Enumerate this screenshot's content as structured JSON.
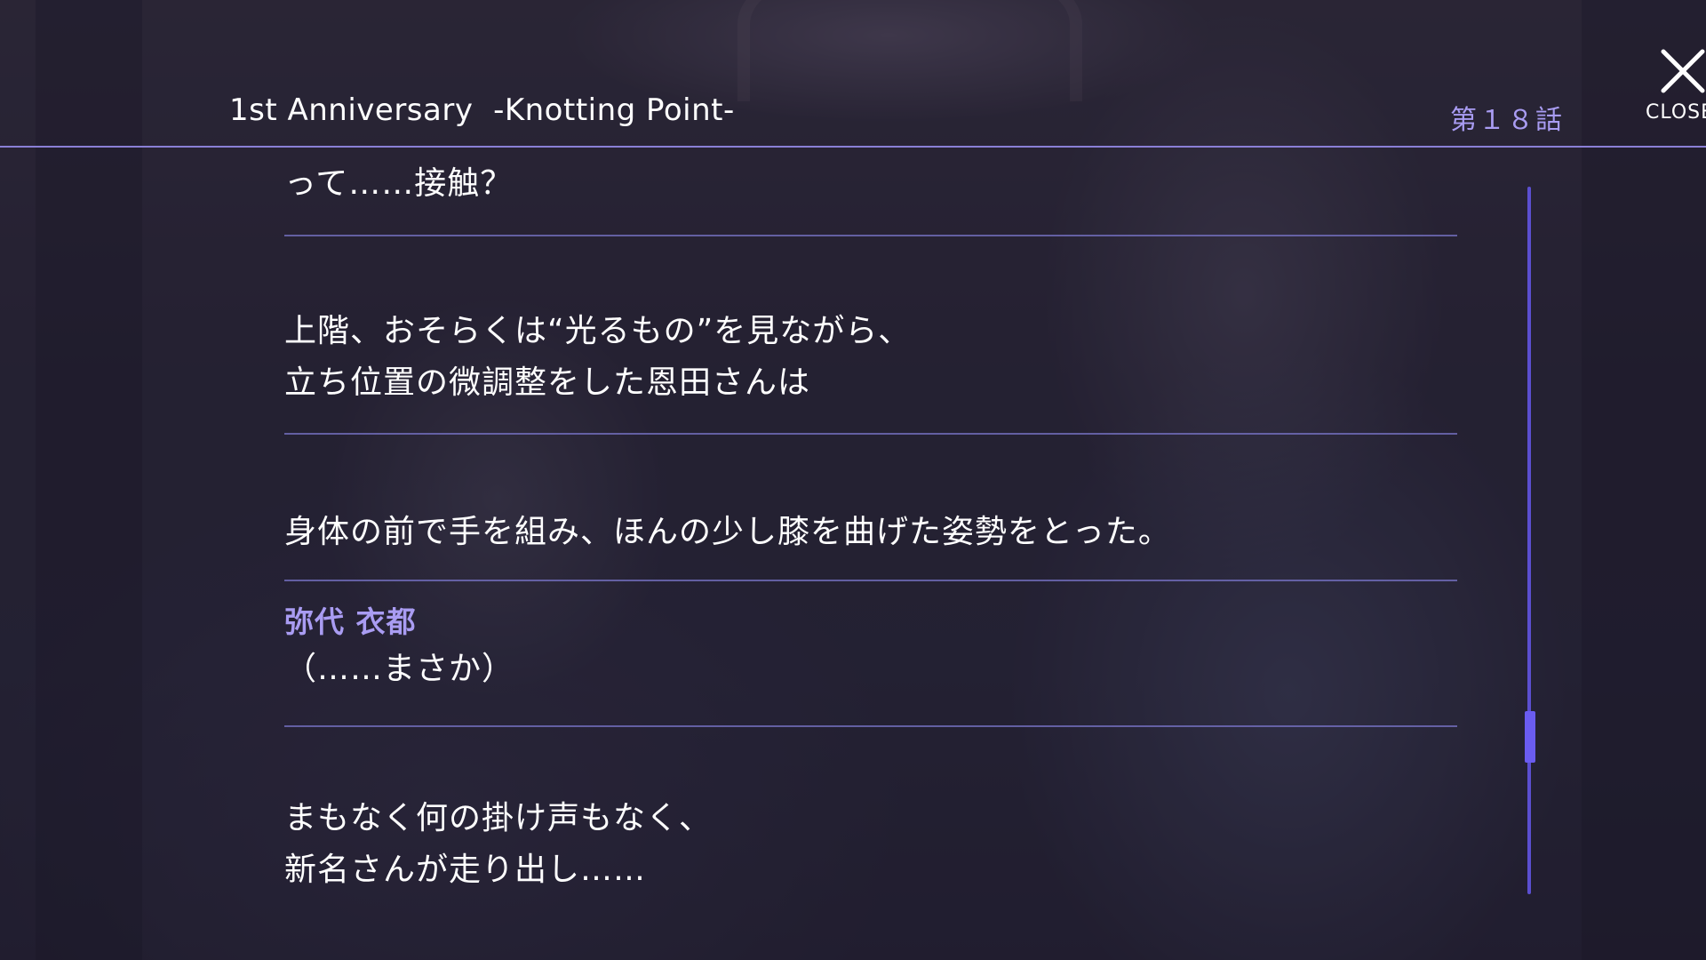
{
  "header": {
    "title": "1st Anniversary  -Knotting Point-",
    "chapter": "第１８話",
    "close_label": "CLOSE"
  },
  "colors": {
    "accent": "#a99cf2",
    "divider": "#7874c8",
    "scrollbar": "#5b4fd0",
    "text": "#ffffff"
  },
  "log": {
    "entries": [
      {
        "speaker": "",
        "text": "って……接触？"
      },
      {
        "speaker": "",
        "text": "上階、おそらくは“光るもの”を見ながら、\n立ち位置の微調整をした恩田さんは"
      },
      {
        "speaker": "",
        "text": "身体の前で手を組み、ほんの少し膝を曲げた姿勢をとった。"
      },
      {
        "speaker": "弥代 衣都",
        "text": "（……まさか）"
      },
      {
        "speaker": "",
        "text": "まもなく何の掛け声もなく、\n新名さんが走り出し……"
      }
    ]
  },
  "scrollbar": {
    "position": 0.8,
    "icon": "scroll-thumb"
  },
  "icons": {
    "close": "close-icon"
  }
}
